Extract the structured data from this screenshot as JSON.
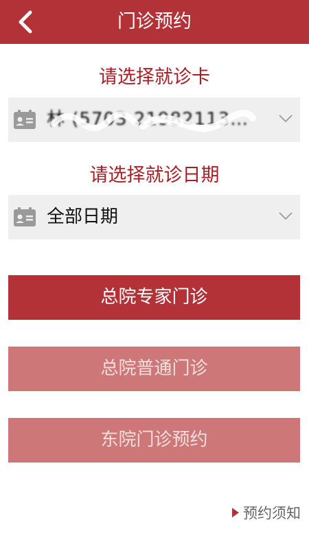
{
  "header": {
    "title": "门诊预约"
  },
  "card_section": {
    "label": "请选择就诊卡",
    "selected_value": "林 (5703 21982113…"
  },
  "date_section": {
    "label": "请选择就诊日期",
    "selected_value": "全部日期"
  },
  "buttons": {
    "expert": "总院专家门诊",
    "general": "总院普通门诊",
    "east": "东院门诊预约"
  },
  "footer": {
    "notice_label": "预约须知"
  },
  "colors": {
    "primary": "#b23237",
    "primary_disabled": "#cd7778",
    "label_red": "#a81e25"
  }
}
